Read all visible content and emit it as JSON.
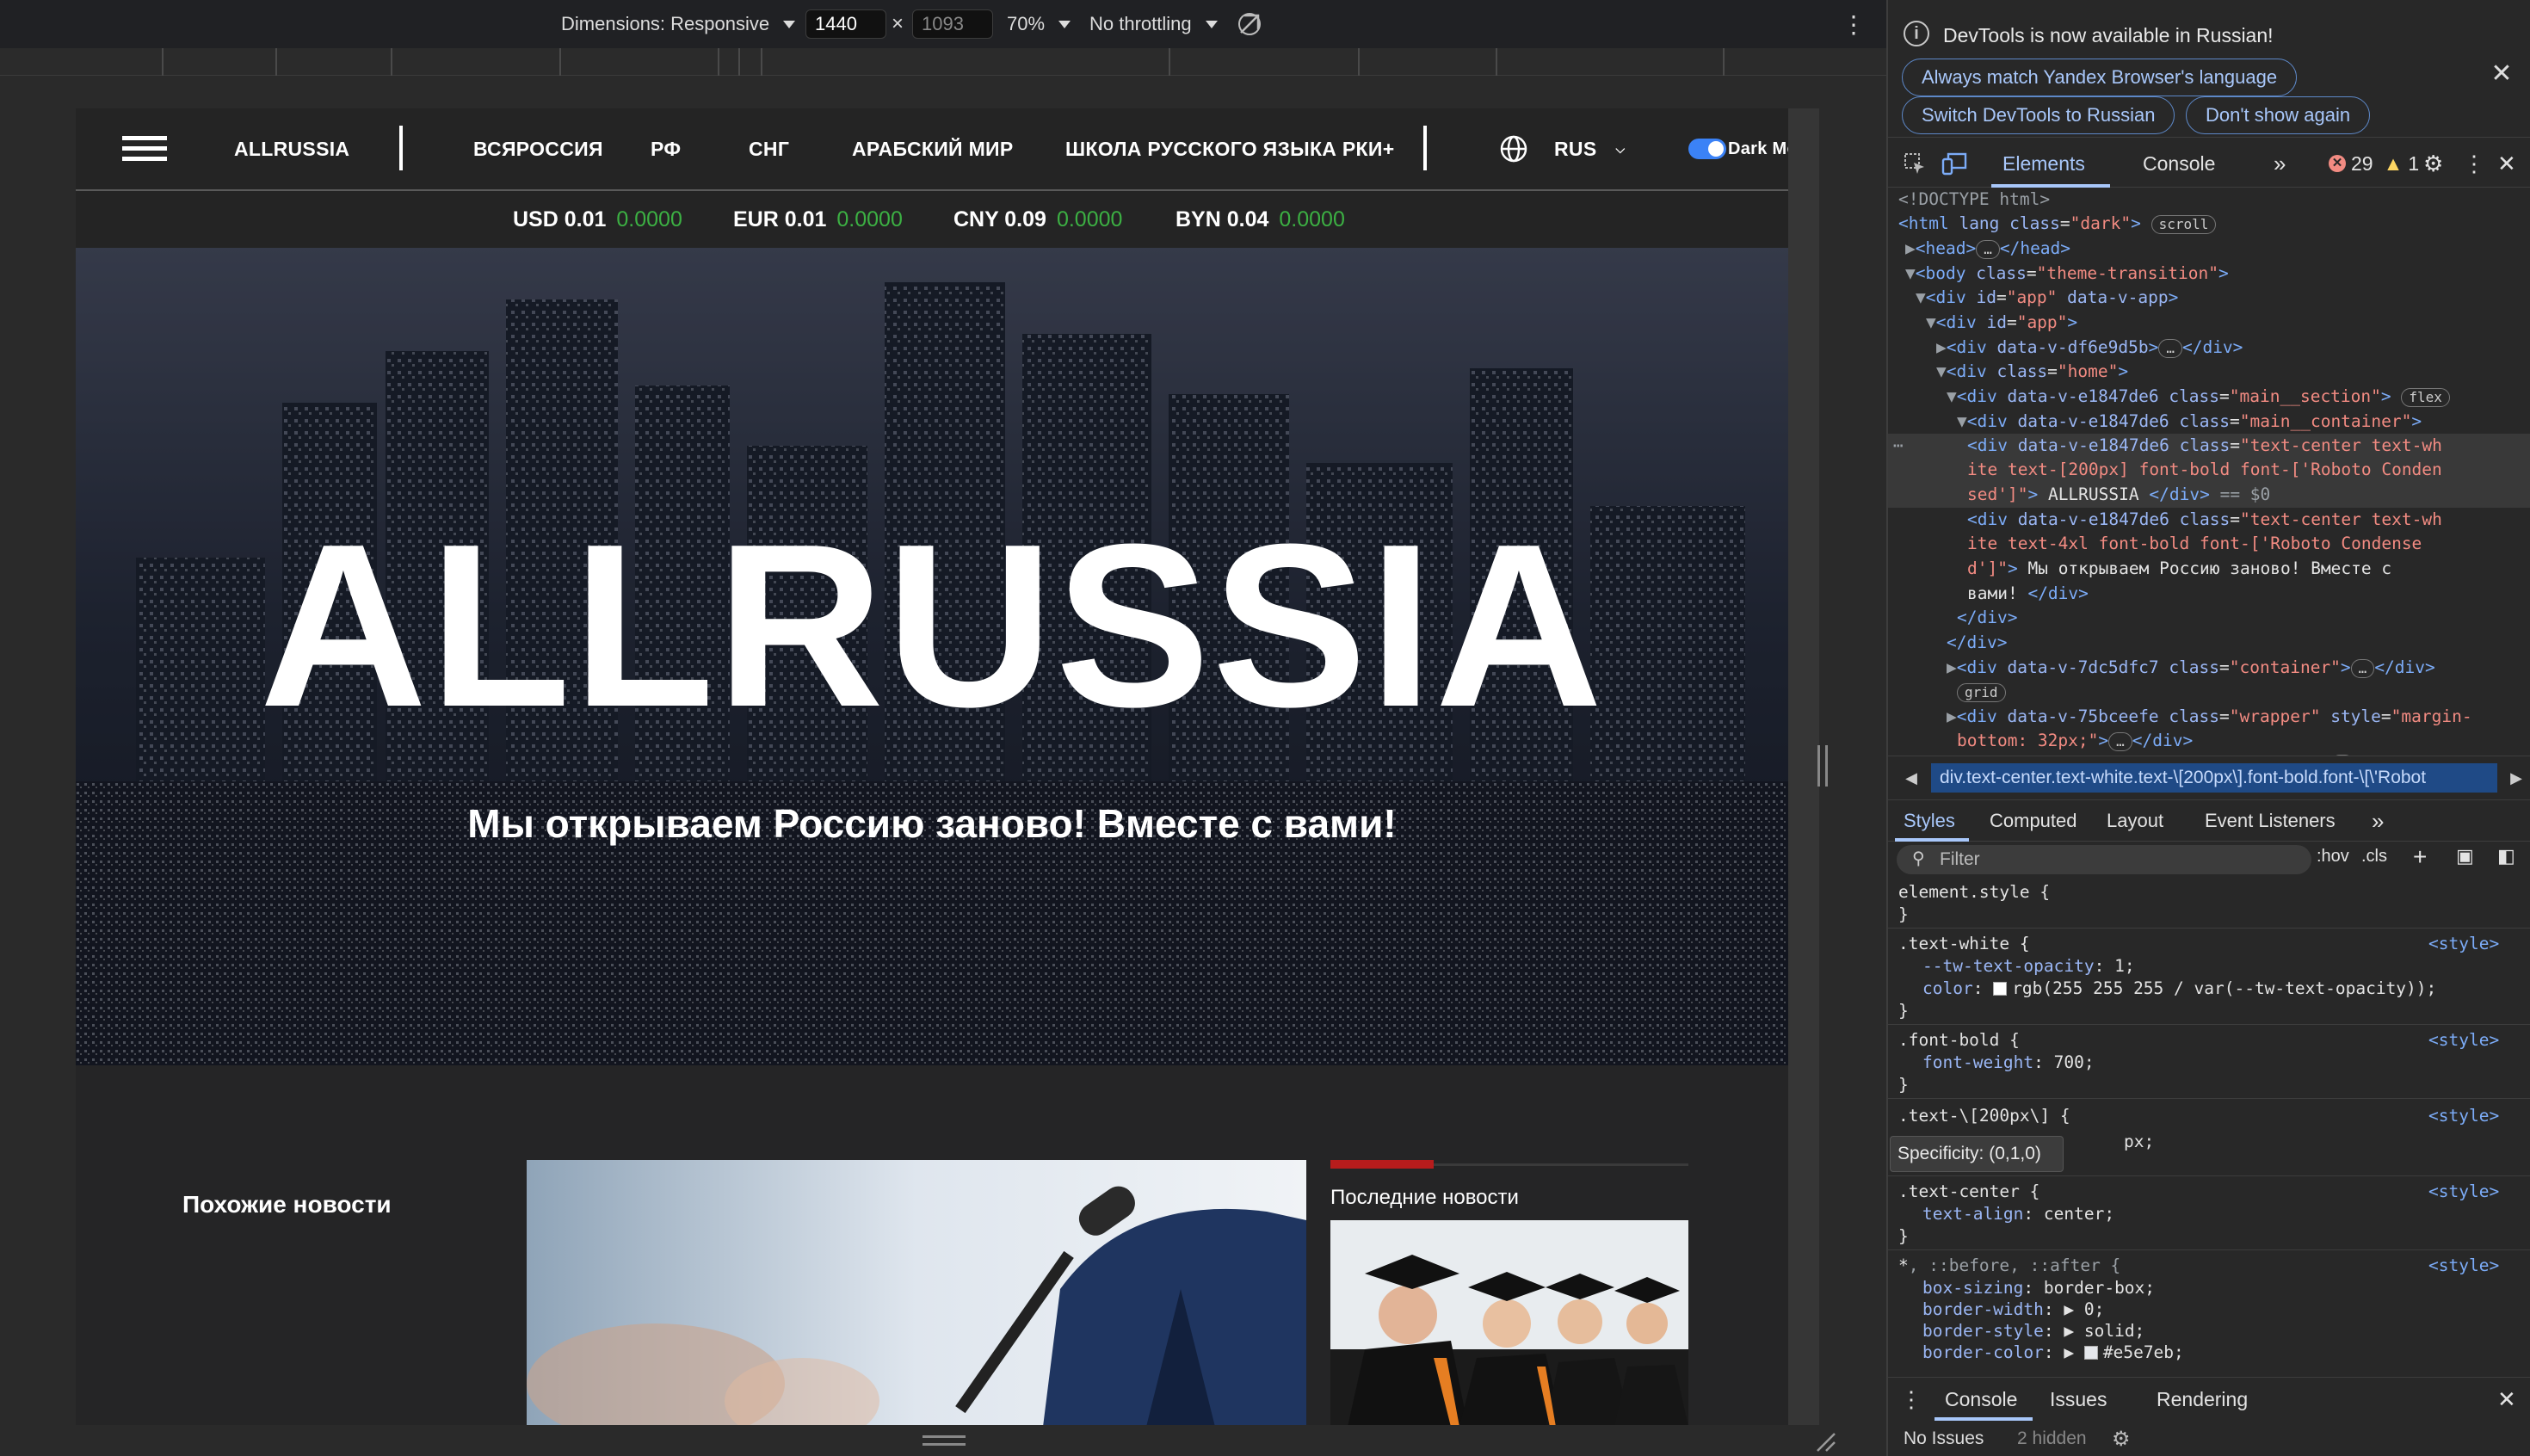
{
  "device_toolbar": {
    "dimensions_label": "Dimensions: Responsive",
    "width_value": "1440",
    "height_placeholder": "1093",
    "times": "×",
    "zoom": "70%",
    "throttling": "No throttling"
  },
  "site": {
    "nav": {
      "brand": "ALLRUSSIA",
      "links": [
        "ВСЯРОССИЯ",
        "РФ",
        "СНГ",
        "АРАБСКИЙ МИР",
        "ШКОЛА РУССКОГО ЯЗЫКА РКИ+"
      ],
      "language": "RUS",
      "dark_mode_label": "Dark Mode"
    },
    "currencies": [
      {
        "label": "USD 0.01",
        "change": "0.0000"
      },
      {
        "label": "EUR 0.01",
        "change": "0.0000"
      },
      {
        "label": "CNY 0.09",
        "change": "0.0000"
      },
      {
        "label": "BYN 0.04",
        "change": "0.0000"
      }
    ],
    "hero": {
      "title": "ALLRUSSIA",
      "subtitle": "Мы открываем Россию заново! Вместе с вами!"
    },
    "related_news_title": "Похожие новости",
    "latest_news_title": "Последние новости"
  },
  "devtools": {
    "banner": {
      "message": "DevTools is now available in Russian!",
      "btn_match": "Always match Yandex Browser's language",
      "btn_switch": "Switch DevTools to Russian",
      "btn_dont_show": "Don't show again"
    },
    "tabs": {
      "elements": "Elements",
      "console": "Console",
      "errors": "29",
      "warnings": "1"
    },
    "dom": {
      "l1": "<!DOCTYPE html>",
      "l2_badge": "scroll",
      "l6_badge": "flex",
      "l12_badge": "grid",
      "selected_text": "ALLRUSSIA",
      "selected_marker": "== $0",
      "second_text_a": "Мы открываем Россию заново! Вместе с",
      "second_text_b": "вами!"
    },
    "breadcrumb": "div.text-center.text-white.text-\\[200px\\].font-bold.font-\\[\\'Robot",
    "styles_tabs": {
      "styles": "Styles",
      "computed": "Computed",
      "layout": "Layout",
      "event_listeners": "Event Listeners"
    },
    "filter": {
      "placeholder": "Filter",
      "hov": ":hov",
      "cls": ".cls"
    },
    "styles": {
      "element_style": "element.style {",
      "src": "<style>",
      "text_white_sel": ".text-white {",
      "tw_opacity_prop": "--tw-text-opacity",
      "tw_opacity_val": "1;",
      "color_prop": "color",
      "color_val": "rgb(255 255 255 / var(--tw-text-opacity));",
      "font_bold_sel": ".font-bold {",
      "font_weight_prop": "font-weight",
      "font_weight_val": "700;",
      "text_200_sel": ".text-\\[200px\\] {",
      "text_200_tail": "px;",
      "text_center_sel": ".text-center {",
      "text_align_prop": "text-align",
      "text_align_val": "center;",
      "universal_sel_a": "*",
      "universal_sel_b": ", ::before, ::after {",
      "box_sizing_prop": "box-sizing",
      "box_sizing_val": "border-box;",
      "border_width_prop": "border-width",
      "border_width_val": "0;",
      "border_style_prop": "border-style",
      "border_style_val": "solid;",
      "border_color_prop": "border-color",
      "border_color_val": "#e5e7eb;",
      "tooltip": "Specificity: (0,1,0)"
    },
    "drawer": {
      "console": "Console",
      "issues": "Issues",
      "rendering": "Rendering",
      "no_issues": "No Issues",
      "hidden": "2 hidden"
    }
  },
  "colors": {
    "accent": "#a8c7fa",
    "change_green": "#3cb043",
    "news_red": "#b71c1c"
  }
}
